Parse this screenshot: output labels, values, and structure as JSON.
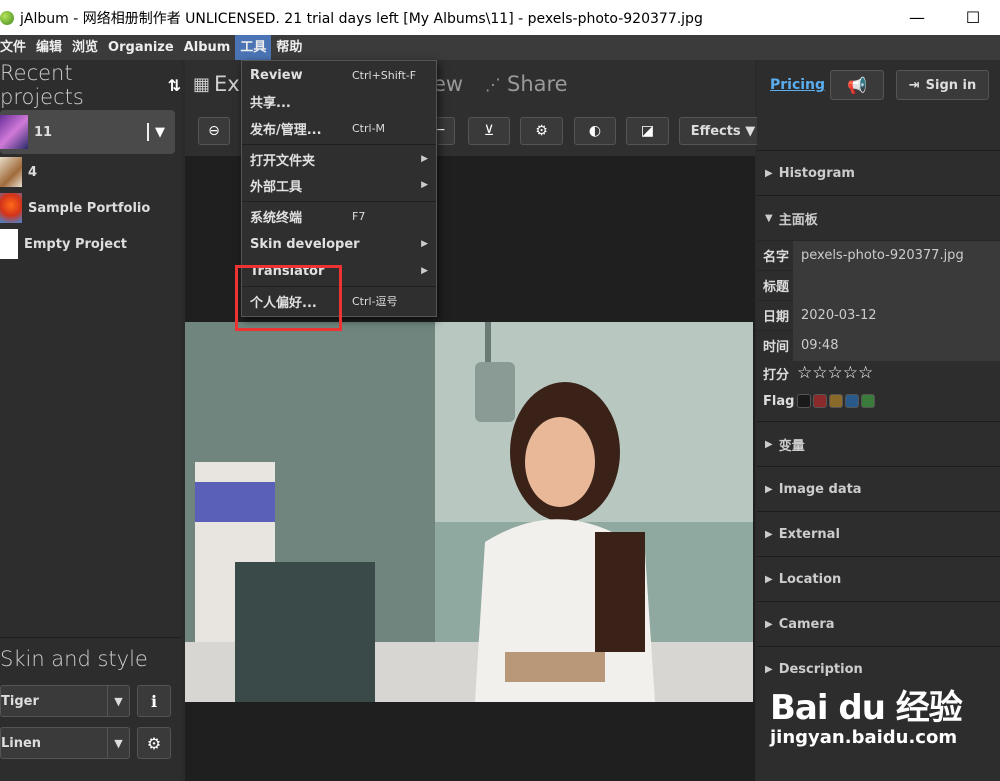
{
  "window": {
    "title": "jAlbum - 网络相册制作者 UNLICENSED. 21 trial days left [My Albums\\11] - pexels-photo-920377.jpg",
    "minimize": "—",
    "maximize": "☐"
  },
  "menubar": [
    "文件",
    "编辑",
    "浏览",
    "Organize",
    "Album",
    "工具",
    "帮助"
  ],
  "left": {
    "header": "Recent projects",
    "sort_icon": "⇅",
    "projects": [
      {
        "name": "11"
      },
      {
        "name": "4"
      },
      {
        "name": "Sample Portfolio"
      },
      {
        "name": "Empty Project"
      }
    ],
    "skin_title": "Skin and style",
    "skin_value": "Tiger",
    "style_value": "Linen"
  },
  "center": {
    "tab_explore": "Ex",
    "tab_preview_tail": "ew",
    "tab_share": "Share",
    "effects_label": "Effects ▼"
  },
  "menu": {
    "items": [
      {
        "label": "Review",
        "shortcut": "Ctrl+Shift-F"
      },
      {
        "label": "共享...",
        "shortcut": ""
      },
      {
        "label": "发布/管理...",
        "shortcut": "Ctrl-M"
      },
      {
        "label": "打开文件夹",
        "shortcut": ""
      },
      {
        "label": "外部工具",
        "shortcut": ""
      },
      {
        "label": "系统终端",
        "shortcut": "F7"
      },
      {
        "label": "Skin developer",
        "shortcut": ""
      },
      {
        "label": "Translator",
        "shortcut": ""
      },
      {
        "label": "个人偏好...",
        "shortcut": "Ctrl-逗号"
      }
    ]
  },
  "right": {
    "pricing": "Pricing",
    "sign_in": "Sign in",
    "histogram": "Histogram",
    "main_panel": "主面板",
    "props": {
      "name_key": "名字",
      "name_val": "pexels-photo-920377.jpg",
      "title_key": "标题",
      "title_val": "",
      "date_key": "日期",
      "date_val": "2020-03-12",
      "time_key": "时间",
      "time_val": "09:48",
      "rating_key": "打分",
      "flag_key": "Flag"
    },
    "sections": [
      "变量",
      "Image data",
      "External",
      "Location",
      "Camera",
      "Description"
    ],
    "flag_colors": [
      "#1a1a1a",
      "#8a2a2a",
      "#8a6a2a",
      "#2a5a8a",
      "#3a7a3a"
    ]
  },
  "watermark": {
    "logo": "Bai du 经验",
    "url": "jingyan.baidu.com"
  }
}
